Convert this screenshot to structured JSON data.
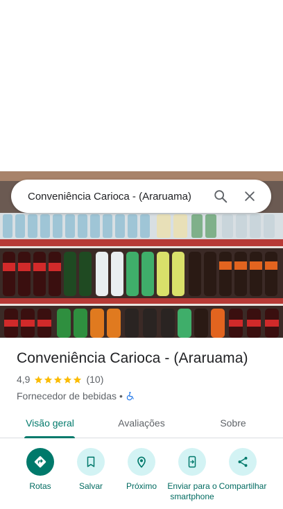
{
  "search": {
    "query": "Conveniência Carioca - (Araruama)"
  },
  "place": {
    "title": "Conveniência Carioca - (Araruama)",
    "rating": "4,9",
    "stars": 5,
    "review_count": "(10)",
    "category": "Fornecedor de bebidas",
    "separator": "•"
  },
  "tabs": [
    {
      "label": "Visão geral",
      "active": true
    },
    {
      "label": "Avaliações",
      "active": false
    },
    {
      "label": "Sobre",
      "active": false
    }
  ],
  "actions": [
    {
      "label": "Rotas",
      "icon": "directions-icon"
    },
    {
      "label": "Salvar",
      "icon": "bookmark-icon"
    },
    {
      "label": "Próximo",
      "icon": "nearby-icon"
    },
    {
      "label": "Enviar para o smartphone",
      "icon": "send-to-phone-icon"
    },
    {
      "label": "Compartilhar",
      "icon": "share-icon"
    }
  ],
  "colors": {
    "accent": "#00796b",
    "action_bg": "#d3f3f4",
    "star": "#fbbc04",
    "wheelchair": "#1a73e8"
  }
}
